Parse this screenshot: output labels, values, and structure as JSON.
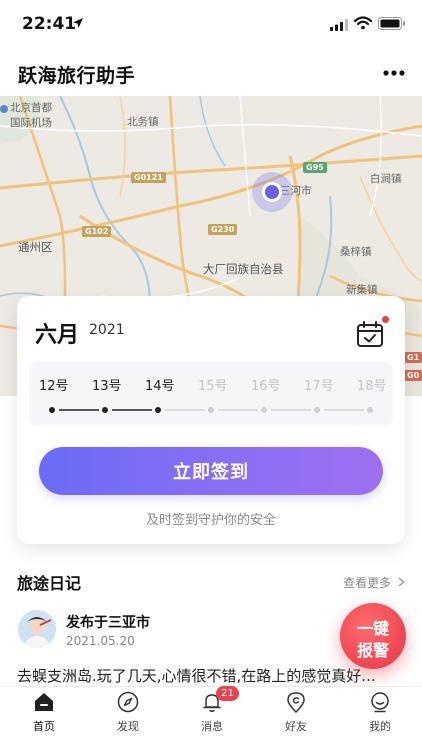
{
  "status_bar": {
    "time": "22:41"
  },
  "header": {
    "title": "跃海旅行助手",
    "more_icon": "more-dots-icon"
  },
  "map": {
    "labels": {
      "airport": "北京首都\n国际机场",
      "airport_line1": "北京首都",
      "airport_line2": "国际机场",
      "beiwu": "北务镇",
      "sanhe": "三河市",
      "baijian": "白涧镇",
      "tongzhou": "通州区",
      "dachang": "大厂回族自治县",
      "sangzi": "桑梓镇",
      "xinji": "新集镇"
    },
    "shields": {
      "g95": "G95",
      "g0121": "G0121",
      "g102": "G102",
      "g230": "G230",
      "g1": "G1",
      "g0": "G0"
    }
  },
  "checkin": {
    "month": "六月",
    "year": "2021",
    "dates": [
      "12号",
      "13号",
      "14号",
      "15号",
      "16号",
      "17号",
      "18号"
    ],
    "checked_count": 3,
    "button_label": "立即签到",
    "hint": "及时签到守护你的安全"
  },
  "diary": {
    "section_title": "旅途日记",
    "see_more": "查看更多",
    "post": {
      "location": "发布于三亚市",
      "date": "2021.05.20",
      "text": "去蜈支洲岛.玩了几天,心情很不错,在路上的感觉真好..."
    }
  },
  "sos": {
    "line1": "一键",
    "line2": "报警"
  },
  "tabs": [
    {
      "label": "首页",
      "icon": "home-icon",
      "active": true
    },
    {
      "label": "发现",
      "icon": "compass-icon",
      "active": false
    },
    {
      "label": "消息",
      "icon": "bell-icon",
      "active": false,
      "badge": "21"
    },
    {
      "label": "好友",
      "icon": "friends-location-icon",
      "active": false
    },
    {
      "label": "我的",
      "icon": "profile-icon",
      "active": false
    }
  ],
  "colors": {
    "accent": "#6d5fe8",
    "sos": "#f04a56",
    "badge": "#e8424e"
  }
}
